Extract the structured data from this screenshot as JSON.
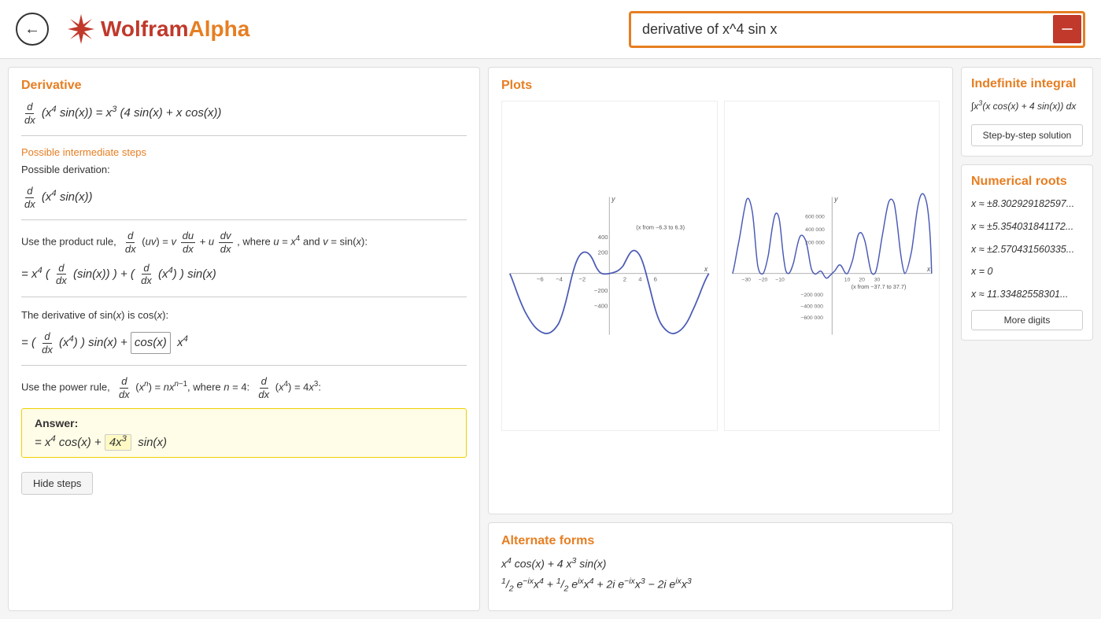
{
  "header": {
    "back_button_label": "←",
    "logo_wolfram": "Wolfram",
    "logo_alpha": "Alpha",
    "search_query": "derivative of x^4 sin x",
    "search_clear_label": "×"
  },
  "derivative_panel": {
    "title": "Derivative",
    "main_formula": "d/dx(x⁴ sin(x)) = x³(4 sin(x) + x cos(x))",
    "intermediate_link": "Possible intermediate steps",
    "possible_derivation": "Possible derivation:",
    "steps": [
      "Use the product rule, d/dx(uv) = v·du/dx + u·dv/dx, where u = x⁴ and v = sin(x):",
      "= x⁴(d/dx(sin(x))) + (d/dx(x⁴))sin(x)",
      "The derivative of sin(x) is cos(x):",
      "= (d/dx(x⁴))sin(x) + cos(x) · x⁴",
      "Use the power rule, d/dx(xⁿ) = n·xⁿ⁻¹, where n = 4: d/dx(x⁴) = 4x³:"
    ],
    "answer_label": "Answer:",
    "answer_formula": "= x⁴ cos(x) + 4x³ sin(x)",
    "hide_steps_button": "Hide steps"
  },
  "plots_panel": {
    "title": "Plots",
    "plot1_range": "(x from −6.3 to 6.3)",
    "plot2_range": "(x from −37.7 to 37.7)"
  },
  "alternate_forms_panel": {
    "title": "Alternate forms",
    "form1": "x⁴ cos(x) + 4 x³ sin(x)",
    "form2": "½ e^(−ix) x⁴ + ½ e^(ix) x⁴ + 2i e^(−ix) x³ − 2i e^(ix) x³"
  },
  "indefinite_integral_panel": {
    "title": "Indefinite integral",
    "formula": "∫ x³(x cos(x) + 4 sin(x)) dx",
    "step_by_step_button": "Step-by-step solution"
  },
  "numerical_roots_panel": {
    "title": "Numerical roots",
    "roots": [
      "x ≈ ±8.30292918259706...",
      "x ≈ ±5.35403184117261...",
      "x ≈ ±2.57043156033591...",
      "x = 0",
      "x ≈ 11.33482558301878..."
    ],
    "more_digits_button": "More digits"
  }
}
